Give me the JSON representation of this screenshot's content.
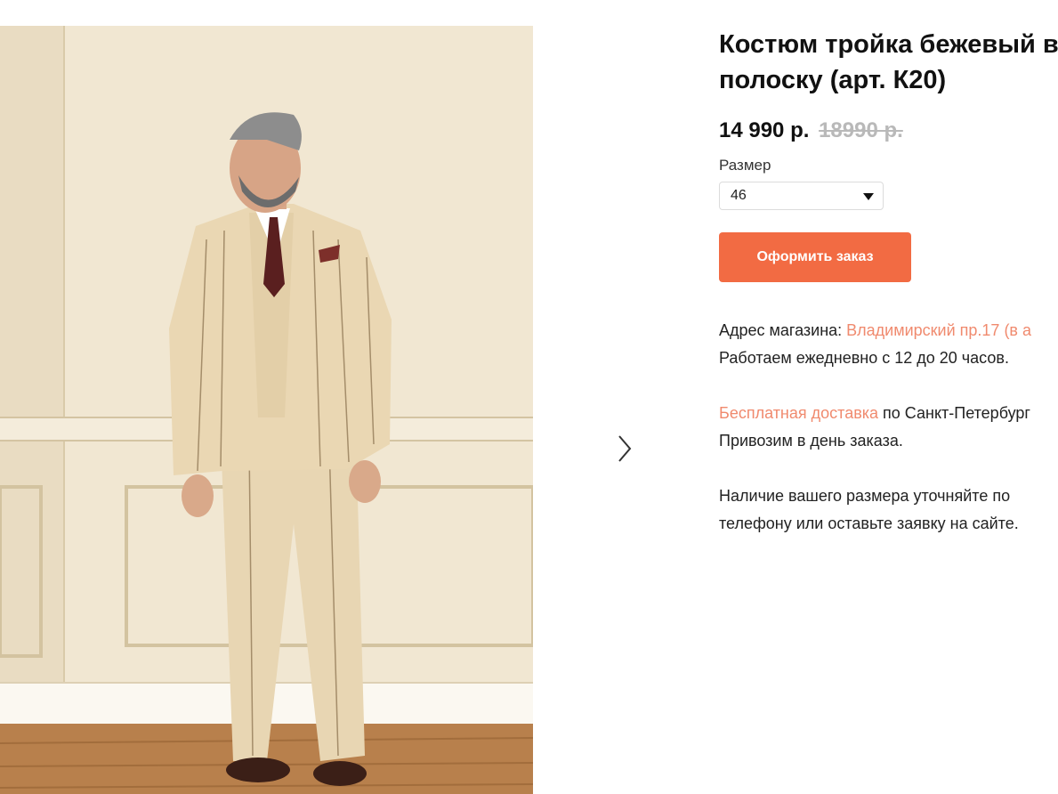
{
  "product": {
    "title_line1": "Костюм тройка бежевый в",
    "title_line2": "полоску (арт. К20)",
    "price_current": "14 990 р.",
    "price_old": "18990 р."
  },
  "size": {
    "label": "Размер",
    "selected": "46"
  },
  "order_button": {
    "label": "Оформить заказ",
    "color": "#f26b43"
  },
  "store": {
    "address_label": "Адрес магазина: ",
    "address_link": "Владимирский пр.17 (в а",
    "hours": "Работаем ежедневно с 12 до 20 часов."
  },
  "delivery": {
    "link": "Бесплатная доставка",
    "rest": " по Санкт-Петербург",
    "note": "Привозим в день заказа."
  },
  "availability": {
    "line1": "Наличие вашего размера уточняйте по",
    "line2": "телефону или оставьте заявку на сайте."
  },
  "icons": {
    "next": "chevron-right-icon",
    "dropdown": "caret-down-icon"
  },
  "colors": {
    "accent": "#f26b43",
    "link": "#f08a6e",
    "old_price": "#b9b9b9"
  }
}
